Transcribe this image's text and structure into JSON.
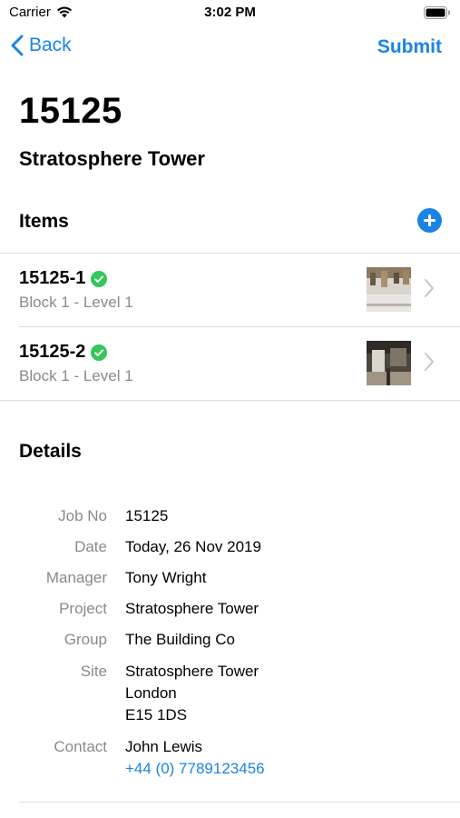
{
  "status": {
    "carrier": "Carrier",
    "time": "3:02 PM"
  },
  "nav": {
    "back_label": "Back",
    "submit_label": "Submit"
  },
  "job": {
    "number": "15125",
    "project": "Stratosphere Tower"
  },
  "items_section": {
    "heading": "Items",
    "items": [
      {
        "title": "15125-1",
        "subtitle": "Block 1 - Level 1",
        "status": "complete",
        "status_color": "#34c759"
      },
      {
        "title": "15125-2",
        "subtitle": "Block 1 - Level 1",
        "status": "complete",
        "status_color": "#34c759"
      }
    ]
  },
  "details_section": {
    "heading": "Details",
    "job_no": {
      "label": "Job No",
      "value": "15125"
    },
    "date": {
      "label": "Date",
      "value": "Today, 26 Nov 2019"
    },
    "manager": {
      "label": "Manager",
      "value": "Tony Wright"
    },
    "project": {
      "label": "Project",
      "value": "Stratosphere Tower"
    },
    "group": {
      "label": "Group",
      "value": "The Building Co"
    },
    "site": {
      "label": "Site",
      "line1": "Stratosphere Tower",
      "line2": "London",
      "line3": "E15 1DS"
    },
    "contact": {
      "label": "Contact",
      "name": "John Lewis",
      "phone": "+44 (0) 7789123456"
    }
  },
  "colors": {
    "accent": "#1a84e6",
    "secondary_text": "#8a8a8e",
    "check": "#34c759"
  }
}
